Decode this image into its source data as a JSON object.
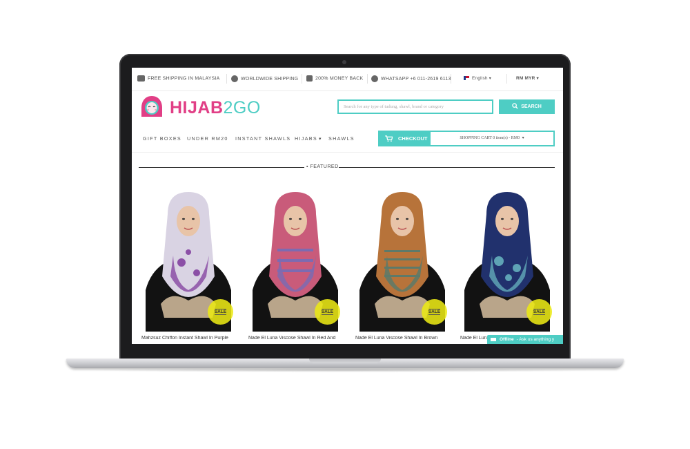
{
  "topbar": {
    "shipping_malaysia": "FREE SHIPPING IN MALAYSIA",
    "worldwide_shipping": "WORLDWIDE SHIPPING",
    "money_back": "200% MONEY BACK",
    "whatsapp": "WHATSAPP +6 011-2619 6113",
    "language": "English",
    "currency": "RM MYR"
  },
  "brand": {
    "name_main": "HIJAB",
    "name_accent": "2GO",
    "primary_color": "#e13f86",
    "accent_color": "#4ecdc4"
  },
  "search": {
    "placeholder": "Search for any type of tudung, shawl, brand or category",
    "button_label": "SEARCH"
  },
  "nav": {
    "items": [
      "GIFT BOXES",
      "UNDER RM20",
      "INSTANT SHAWLS",
      "HIJABS",
      "SHAWLS"
    ]
  },
  "cart": {
    "checkout_label": "CHECKOUT",
    "summary": "SHOPPING CART 0 item(s) - RM0"
  },
  "featured": {
    "heading": "FEATURED",
    "products": [
      {
        "title": "Mahzsuz Chiffon Instant Shawl In Purple",
        "badge": "SALE",
        "colors": [
          "#d9d3e3",
          "#8b4fa6"
        ]
      },
      {
        "title": "Nade El Luna Viscose Shawl In Red And",
        "badge": "SALE",
        "colors": [
          "#c95b7a",
          "#7c6bb1"
        ]
      },
      {
        "title": "Nade El Luna Viscose Shawl In Brown",
        "badge": "SALE",
        "colors": [
          "#b7733a",
          "#5d7a6a"
        ]
      },
      {
        "title": "Nade El Luna",
        "badge": "SALE",
        "colors": [
          "#21316d",
          "#5ea3b5"
        ]
      }
    ]
  },
  "chat": {
    "status": "Offline",
    "message": "- Ask us anything y"
  }
}
